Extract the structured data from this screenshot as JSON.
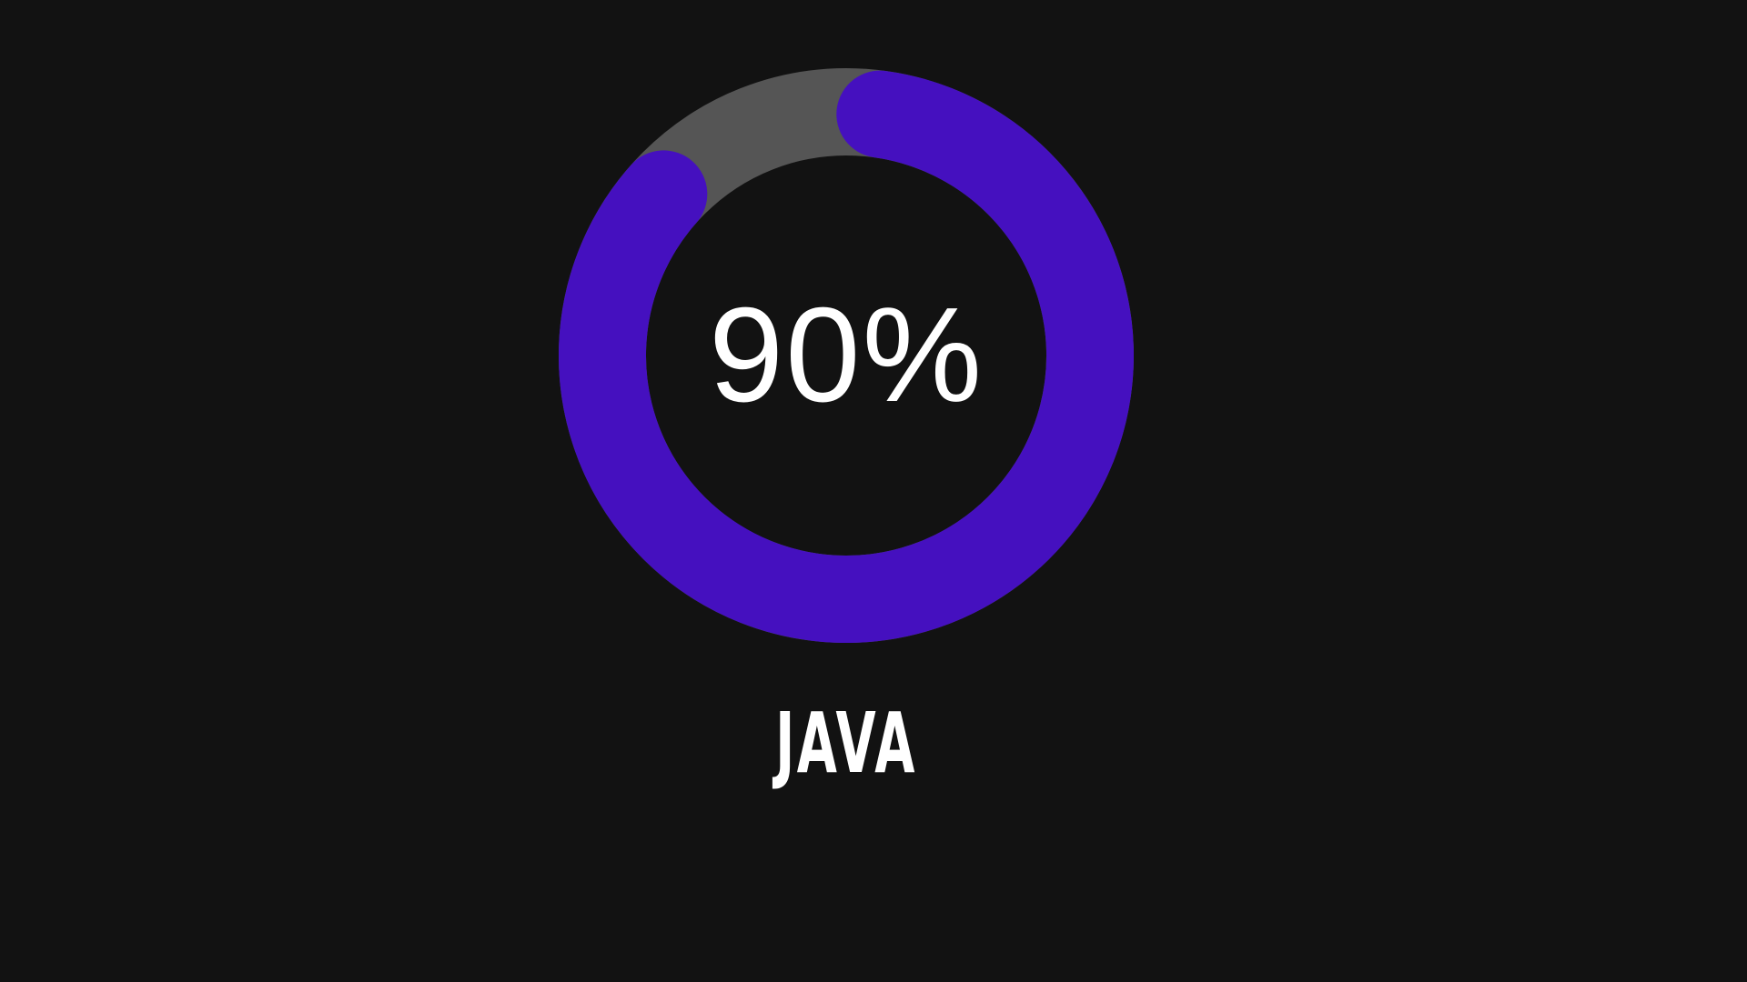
{
  "skill": {
    "label": "JAVA",
    "percent_text": "90%",
    "progress": 0.9
  },
  "colors": {
    "background": "#121212",
    "track": "#555555",
    "progress": "#4510bf",
    "text": "#ffffff"
  }
}
